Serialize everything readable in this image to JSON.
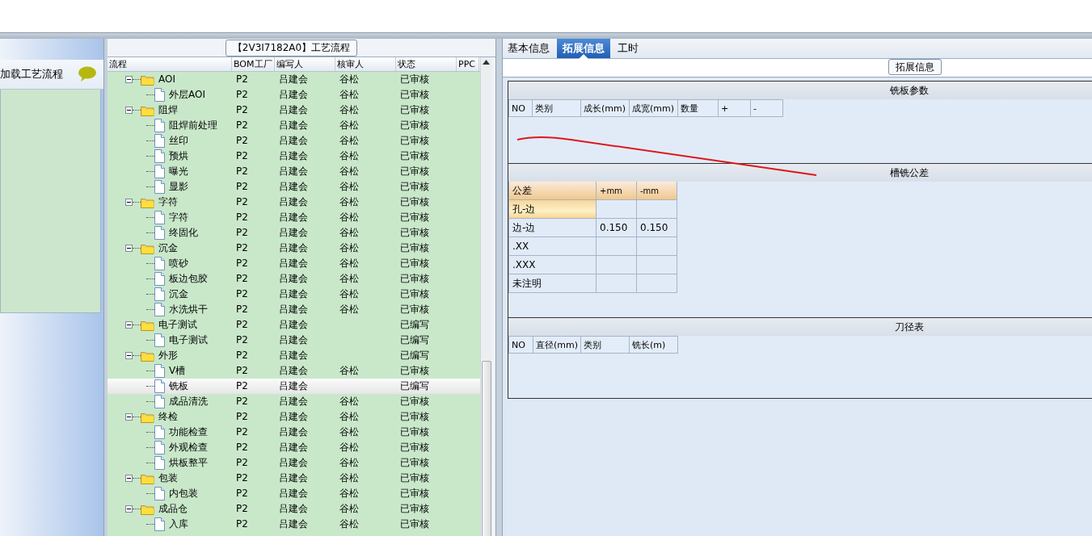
{
  "left_panel": {
    "title": "加载工艺流程"
  },
  "process_panel": {
    "title": "【2V3I7182A0】工艺流程",
    "columns": [
      "流程",
      "BOM工厂",
      "编写人",
      "核审人",
      "状态",
      "PPC"
    ],
    "rows": [
      {
        "name": "AOI",
        "kind": "folder",
        "expanded": true,
        "selected": false,
        "factory": "P2",
        "writer": "吕建会",
        "reviewer": "谷松",
        "status": "已审核",
        "children": [
          {
            "name": "外层AOI",
            "kind": "file",
            "selected": false,
            "factory": "P2",
            "writer": "吕建会",
            "reviewer": "谷松",
            "status": "已审核"
          }
        ]
      },
      {
        "name": "阻焊",
        "kind": "folder",
        "expanded": true,
        "selected": false,
        "factory": "P2",
        "writer": "吕建会",
        "reviewer": "谷松",
        "status": "已审核",
        "children": [
          {
            "name": "阻焊前处理",
            "kind": "file",
            "selected": false,
            "factory": "P2",
            "writer": "吕建会",
            "reviewer": "谷松",
            "status": "已审核"
          },
          {
            "name": "丝印",
            "kind": "file",
            "selected": false,
            "factory": "P2",
            "writer": "吕建会",
            "reviewer": "谷松",
            "status": "已审核"
          },
          {
            "name": "预烘",
            "kind": "file",
            "selected": false,
            "factory": "P2",
            "writer": "吕建会",
            "reviewer": "谷松",
            "status": "已审核"
          },
          {
            "name": "曝光",
            "kind": "file",
            "selected": false,
            "factory": "P2",
            "writer": "吕建会",
            "reviewer": "谷松",
            "status": "已审核"
          },
          {
            "name": "显影",
            "kind": "file",
            "selected": false,
            "factory": "P2",
            "writer": "吕建会",
            "reviewer": "谷松",
            "status": "已审核"
          }
        ]
      },
      {
        "name": "字符",
        "kind": "folder",
        "expanded": true,
        "selected": false,
        "factory": "P2",
        "writer": "吕建会",
        "reviewer": "谷松",
        "status": "已审核",
        "children": [
          {
            "name": "字符",
            "kind": "file",
            "selected": false,
            "factory": "P2",
            "writer": "吕建会",
            "reviewer": "谷松",
            "status": "已审核"
          },
          {
            "name": "终固化",
            "kind": "file",
            "selected": false,
            "factory": "P2",
            "writer": "吕建会",
            "reviewer": "谷松",
            "status": "已审核"
          }
        ]
      },
      {
        "name": "沉金",
        "kind": "folder",
        "expanded": true,
        "selected": false,
        "factory": "P2",
        "writer": "吕建会",
        "reviewer": "谷松",
        "status": "已审核",
        "children": [
          {
            "name": "喷砂",
            "kind": "file",
            "selected": false,
            "factory": "P2",
            "writer": "吕建会",
            "reviewer": "谷松",
            "status": "已审核"
          },
          {
            "name": "板边包胶",
            "kind": "file",
            "selected": false,
            "factory": "P2",
            "writer": "吕建会",
            "reviewer": "谷松",
            "status": "已审核"
          },
          {
            "name": "沉金",
            "kind": "file",
            "selected": false,
            "factory": "P2",
            "writer": "吕建会",
            "reviewer": "谷松",
            "status": "已审核"
          },
          {
            "name": "水洗烘干",
            "kind": "file",
            "selected": false,
            "factory": "P2",
            "writer": "吕建会",
            "reviewer": "谷松",
            "status": "已审核"
          }
        ]
      },
      {
        "name": "电子测试",
        "kind": "folder",
        "expanded": true,
        "selected": false,
        "factory": "P2",
        "writer": "吕建会",
        "status": "已编写",
        "children": [
          {
            "name": "电子测试",
            "kind": "file",
            "selected": false,
            "factory": "P2",
            "writer": "吕建会",
            "status": "已编写"
          }
        ]
      },
      {
        "name": "外形",
        "kind": "folder",
        "expanded": true,
        "selected": false,
        "factory": "P2",
        "writer": "吕建会",
        "status": "已编写",
        "children": [
          {
            "name": "V槽",
            "kind": "file",
            "selected": false,
            "factory": "P2",
            "writer": "吕建会",
            "reviewer": "谷松",
            "status": "已审核"
          },
          {
            "name": "铣板",
            "kind": "file",
            "selected": true,
            "factory": "P2",
            "writer": "吕建会",
            "status": "已编写"
          },
          {
            "name": "成品清洗",
            "kind": "file",
            "selected": false,
            "factory": "P2",
            "writer": "吕建会",
            "reviewer": "谷松",
            "status": "已审核"
          }
        ]
      },
      {
        "name": "终检",
        "kind": "folder",
        "expanded": true,
        "selected": false,
        "factory": "P2",
        "writer": "吕建会",
        "reviewer": "谷松",
        "status": "已审核",
        "children": [
          {
            "name": "功能检查",
            "kind": "file",
            "selected": false,
            "factory": "P2",
            "writer": "吕建会",
            "reviewer": "谷松",
            "status": "已审核"
          },
          {
            "name": "外观检查",
            "kind": "file",
            "selected": false,
            "factory": "P2",
            "writer": "吕建会",
            "reviewer": "谷松",
            "status": "已审核"
          },
          {
            "name": "烘板整平",
            "kind": "file",
            "selected": false,
            "factory": "P2",
            "writer": "吕建会",
            "reviewer": "谷松",
            "status": "已审核"
          }
        ]
      },
      {
        "name": "包装",
        "kind": "folder",
        "expanded": true,
        "selected": false,
        "factory": "P2",
        "writer": "吕建会",
        "reviewer": "谷松",
        "status": "已审核",
        "children": [
          {
            "name": "内包装",
            "kind": "file",
            "selected": false,
            "factory": "P2",
            "writer": "吕建会",
            "reviewer": "谷松",
            "status": "已审核"
          }
        ]
      },
      {
        "name": "成品仓",
        "kind": "folder",
        "expanded": true,
        "selected": false,
        "factory": "P2",
        "writer": "吕建会",
        "reviewer": "谷松",
        "status": "已审核",
        "children": [
          {
            "name": "入库",
            "kind": "file",
            "selected": false,
            "factory": "P2",
            "writer": "吕建会",
            "reviewer": "谷松",
            "status": "已审核"
          }
        ]
      }
    ]
  },
  "detail_panel": {
    "tabs": [
      {
        "label": "基本信息",
        "selected": false
      },
      {
        "label": "拓展信息",
        "selected": true
      },
      {
        "label": "工时",
        "selected": false
      }
    ],
    "group_title": "拓展信息",
    "sections": [
      {
        "title": "铣板参数",
        "kind": "columns",
        "columns": [
          "NO",
          "类别",
          "成长(mm)",
          "成宽(mm)",
          "数量",
          "+",
          "-"
        ]
      },
      {
        "title": "槽铣公差",
        "kind": "tolerance",
        "columns": [
          "公差",
          "+mm",
          "-mm"
        ],
        "rows": [
          {
            "label": "孔-边",
            "selected": true
          },
          {
            "label": "边-边",
            "selected": false,
            "plus": "0.150",
            "minus": "0.150"
          },
          {
            "label": ".XX",
            "selected": false
          },
          {
            "label": ".XXX",
            "selected": false
          },
          {
            "label": "未注明",
            "selected": false
          }
        ]
      },
      {
        "title": "刀径表",
        "kind": "columns",
        "columns": [
          "NO",
          "直径(mm)",
          "类别",
          "铣长(m)"
        ]
      }
    ]
  }
}
